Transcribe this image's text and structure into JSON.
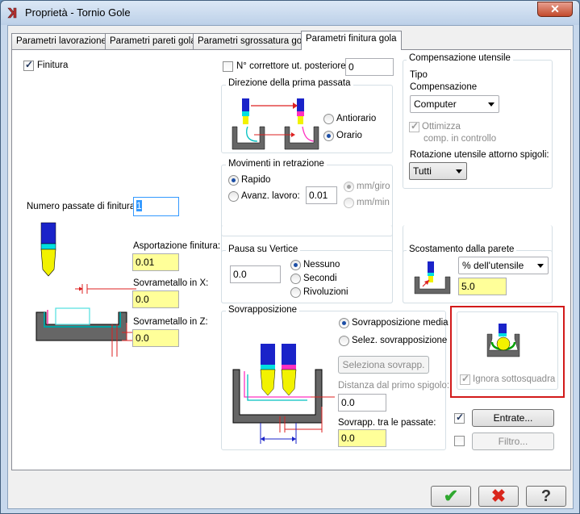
{
  "window": {
    "title": "Proprietà - Tornio Gole",
    "close": "✕"
  },
  "tabs": [
    {
      "label": "Parametri lavorazione"
    },
    {
      "label": "Parametri pareti gola"
    },
    {
      "label": "Parametri sgrossatura gola"
    },
    {
      "label": "Parametri finitura gola"
    }
  ],
  "left": {
    "finitura_label": "Finitura",
    "finitura_checked": true,
    "num_passate_label": "Numero passate di finitura:",
    "num_passate_value": "1",
    "asportazione_label": "Asportazione finitura:",
    "asportazione_value": "0.01",
    "sovra_x_label": "Sovrametallo in  X:",
    "sovra_x_value": "0.0",
    "sovra_z_label": "Sovrametallo in Z:",
    "sovra_z_value": "0.0"
  },
  "correttore": {
    "label": "N° correttore ut. posteriore",
    "value": "0",
    "checked": false
  },
  "direzione": {
    "title": "Direzione della prima passata",
    "antiorario": "Antiorario",
    "orario": "Orario",
    "selected": "orario"
  },
  "movimenti": {
    "title": "Movimenti in retrazione",
    "rapido": "Rapido",
    "avanz": "Avanz. lavoro:",
    "avanz_value": "0.01",
    "mm_giro": "mm/giro",
    "mm_min": "mm/min",
    "selected": "rapido"
  },
  "pausa": {
    "title": "Pausa su Vertice",
    "value": "0.0",
    "nessuno": "Nessuno",
    "secondi": "Secondi",
    "rivoluzioni": "Rivoluzioni",
    "selected": "nessuno"
  },
  "compensazione": {
    "title": "Compensazione utensile",
    "tipo1": "Tipo",
    "tipo2": "Compensazione",
    "tipo_value": "Computer",
    "ottimizza": "Ottimizza",
    "ottimizza_sub": "comp. in controllo",
    "ottimizza_checked": true,
    "rotazione_label": "Rotazione utensile attorno spigoli:",
    "rotazione_value": "Tutti"
  },
  "scostamento": {
    "title": "Scostamento dalla parete",
    "unit": "% dell'utensile",
    "value": "5.0"
  },
  "sovrapposizione": {
    "title": "Sovrapposizione",
    "media": "Sovrapposizione media",
    "selez": "Selez. sovrapposizione",
    "selected": "media",
    "seleziona_btn": "Seleziona sovrapp.",
    "distanza_label": "Distanza dal primo spigolo:",
    "distanza_value": "0.0",
    "tra_passate_label": "Sovrapp. tra le passate:",
    "tra_passate_value": "0.0"
  },
  "sottosquadra": {
    "label": "Ignora sottosquadra",
    "checked": true
  },
  "entrate": {
    "label": "Entrate...",
    "checked": true
  },
  "filtro": {
    "label": "Filtro...",
    "checked": false
  },
  "footer": {
    "ok": "✔",
    "cancel": "✖",
    "help": "?"
  },
  "colors": {
    "ok": "#2fa82f",
    "cancel": "#d9261c",
    "highlight": "#d21a1a",
    "input_yellow": "#ffff99"
  }
}
